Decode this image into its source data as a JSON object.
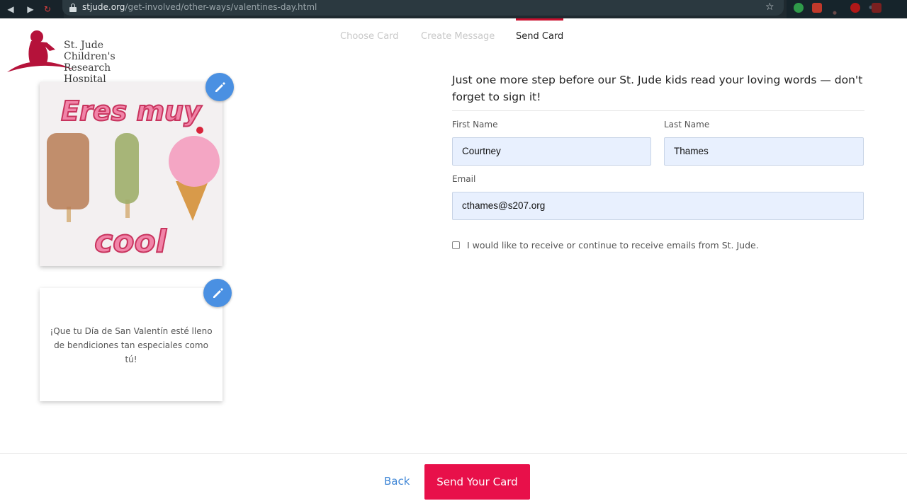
{
  "browser": {
    "url_host": "stjude.org",
    "url_path": "/get-involved/other-ways/valentines-day.html"
  },
  "logo": {
    "line1": "St. Jude Children's",
    "line2": "Research Hospital"
  },
  "steps": [
    {
      "label": "Choose Card",
      "active": false
    },
    {
      "label": "Create Message",
      "active": false
    },
    {
      "label": "Send Card",
      "active": true
    }
  ],
  "card": {
    "image_top_text": "Eres muy",
    "image_bottom_text": "cool",
    "message": "¡Que tu Día de San Valentín esté lleno de bendiciones tan especiales como tú!"
  },
  "form": {
    "intro": "Just one more step before our St. Jude kids read your loving words — don't forget to sign it!",
    "first_name_label": "First Name",
    "first_name_value": "Courtney",
    "last_name_label": "Last Name",
    "last_name_value": "Thames",
    "email_label": "Email",
    "email_value": "cthames@s207.org",
    "optin_label": "I would like to receive or continue to receive emails from St. Jude.",
    "optin_checked": false
  },
  "footer": {
    "back_label": "Back",
    "send_label": "Send Your Card"
  },
  "colors": {
    "brand_red": "#c8102e",
    "send_button": "#e8104a",
    "edit_button": "#4a90e2",
    "link": "#3f86d6",
    "input_bg": "#e8f0fe"
  }
}
